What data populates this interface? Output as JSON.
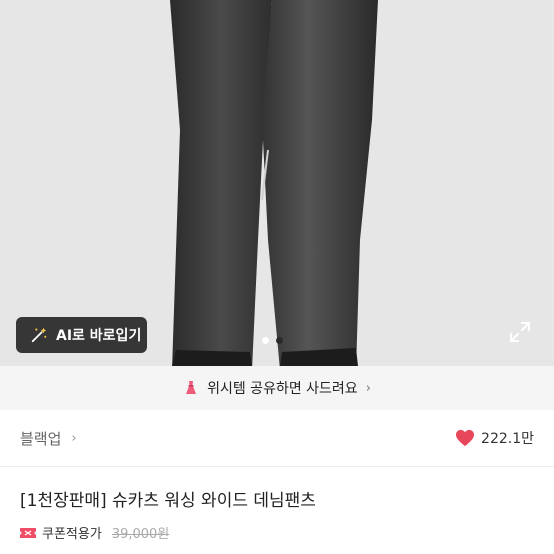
{
  "ai_button": {
    "label": "AI로 바로입기"
  },
  "carousel": {
    "active_color": "#ffffff",
    "inactive_color": "#2a2a2a"
  },
  "promo": {
    "text": "위시템 공유하면 사드려요",
    "chevron": "›"
  },
  "brand": {
    "name": "블랙업",
    "chevron": "›"
  },
  "like": {
    "count": "222.1만",
    "color": "#e8465b"
  },
  "product": {
    "title": "[1천장판매] 슈카츠 워싱 와이드 데님팬츠"
  },
  "price": {
    "coupon_label": "쿠폰적용가",
    "original": "39,000원"
  },
  "icons": [
    "magic-wand-icon",
    "expand-icon",
    "dress-icon",
    "heart-icon",
    "coupon-icon"
  ]
}
